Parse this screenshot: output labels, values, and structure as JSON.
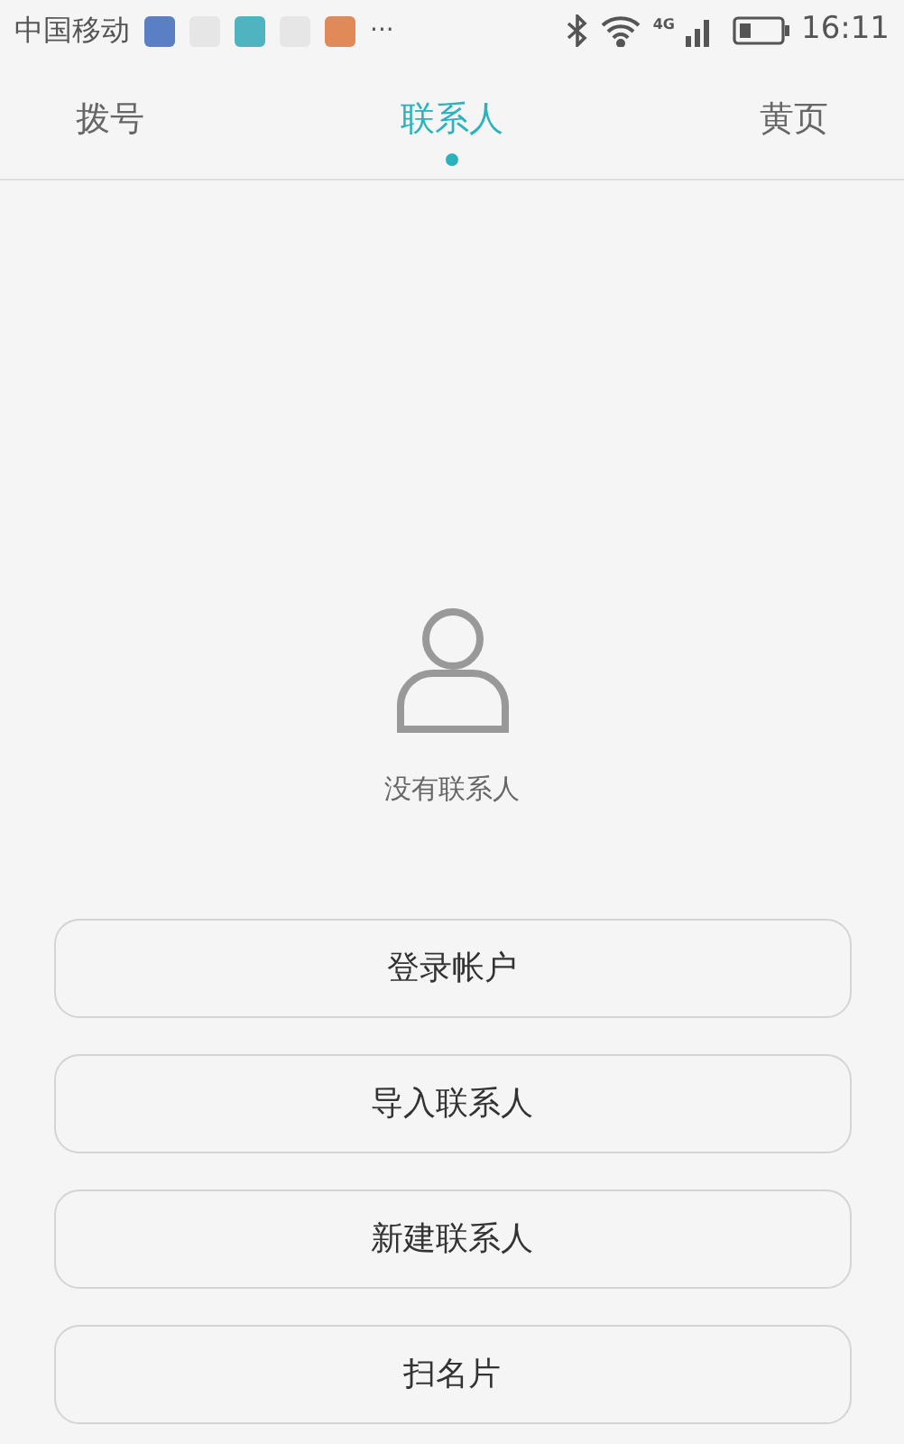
{
  "status_bar": {
    "carrier": "中国移动",
    "notifications": [
      {
        "color": "#5b7fc4"
      },
      {
        "color": "#e6e6e6"
      },
      {
        "color": "#4fb3c0"
      },
      {
        "color": "#e6e6e6"
      },
      {
        "color": "#e08a5a"
      }
    ],
    "more": "···",
    "network": "4G",
    "time": "16:11"
  },
  "tabs": [
    {
      "label": "拨号",
      "selected": false
    },
    {
      "label": "联系人",
      "selected": true
    },
    {
      "label": "黄页",
      "selected": false
    }
  ],
  "empty_state": {
    "message": "没有联系人"
  },
  "buttons": [
    "登录帐户",
    "导入联系人",
    "新建联系人",
    "扫名片"
  ]
}
